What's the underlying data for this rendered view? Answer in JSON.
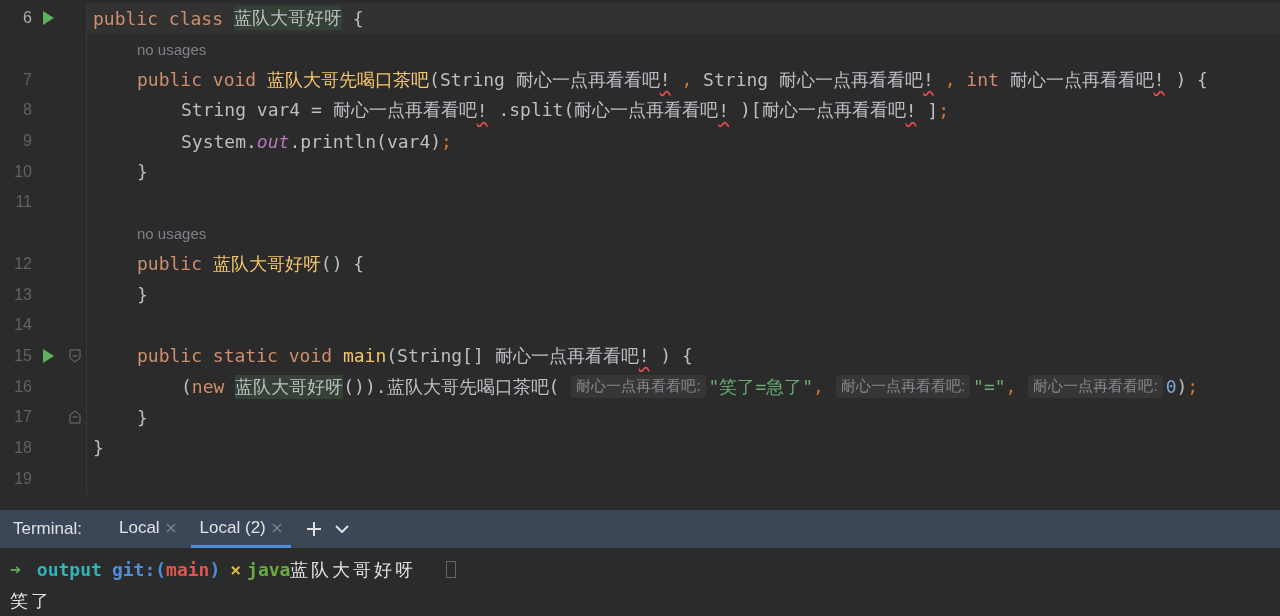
{
  "editor": {
    "rows": [
      {
        "kind": "code",
        "number": "6",
        "current": true,
        "run": true,
        "tokens": [
          {
            "t": "public class ",
            "kind": "kw"
          },
          {
            "t": "蓝队大哥好呀",
            "kind": "usage"
          },
          {
            "t": " {",
            "kind": "plain"
          }
        ],
        "children": [
          {
            "kind": "annotation",
            "text": "no usages"
          },
          {
            "kind": "code",
            "number": "7",
            "current": false,
            "run": false,
            "tokens": [
              {
                "t": "public void ",
                "kind": "kw"
              },
              {
                "t": "蓝队大哥先喝口茶吧",
                "kind": "decl"
              },
              {
                "t": "(String 耐心一点再看看吧",
                "kind": "plain"
              },
              {
                "t": "!",
                "kind": "err"
              },
              {
                "t": " ,",
                "kind": "punct"
              },
              {
                "t": " String 耐心一点再看看吧",
                "kind": "plain"
              },
              {
                "t": "!",
                "kind": "err"
              },
              {
                "t": " ,",
                "kind": "punct"
              },
              {
                "t": " int ",
                "kind": "kw"
              },
              {
                "t": "耐心一点再看看吧",
                "kind": "plain"
              },
              {
                "t": "!",
                "kind": "err"
              },
              {
                "t": " ) {",
                "kind": "plain"
              }
            ],
            "children": [
              {
                "kind": "code",
                "number": "8",
                "current": false,
                "run": false,
                "tokens": [
                  {
                    "t": "String var4 = 耐心一点再看看吧",
                    "kind": "plain"
                  },
                  {
                    "t": "!",
                    "kind": "err"
                  },
                  {
                    "t": " .split(耐心一点再看看吧",
                    "kind": "plain"
                  },
                  {
                    "t": "!",
                    "kind": "err"
                  },
                  {
                    "t": " )[耐心一点再看看吧",
                    "kind": "plain"
                  },
                  {
                    "t": "!",
                    "kind": "err"
                  },
                  {
                    "t": " ]",
                    "kind": "plain"
                  },
                  {
                    "t": ";",
                    "kind": "punct"
                  }
                ]
              },
              {
                "kind": "code",
                "number": "9",
                "current": false,
                "run": false,
                "tokens": [
                  {
                    "t": "System.",
                    "kind": "plain"
                  },
                  {
                    "t": "out",
                    "kind": "field"
                  },
                  {
                    "t": ".println(var4)",
                    "kind": "plain"
                  },
                  {
                    "t": ";",
                    "kind": "punct"
                  }
                ]
              }
            ]
          },
          {
            "kind": "code",
            "number": "10",
            "current": false,
            "run": false,
            "tokens": [
              {
                "t": "}",
                "kind": "plain"
              }
            ]
          },
          {
            "kind": "code",
            "number": "11",
            "current": false,
            "run": false
          },
          {
            "kind": "annotation",
            "text": "no usages"
          },
          {
            "kind": "code",
            "number": "12",
            "current": false,
            "run": false,
            "tokens": [
              {
                "t": "public ",
                "kind": "kw"
              },
              {
                "t": "蓝队大哥好呀",
                "kind": "decl"
              },
              {
                "t": "() {",
                "kind": "plain"
              }
            ]
          },
          {
            "kind": "code",
            "number": "13",
            "current": false,
            "run": false,
            "tokens": [
              {
                "t": "}",
                "kind": "plain"
              }
            ]
          },
          {
            "kind": "code",
            "number": "14",
            "current": false,
            "run": false
          },
          {
            "kind": "code",
            "number": "15",
            "current": false,
            "run": true,
            "fold_marker": {
              "kind": "start"
            },
            "tokens": [
              {
                "t": "public static void ",
                "kind": "kw"
              },
              {
                "t": "main",
                "kind": "decl"
              },
              {
                "t": "(String[] 耐心一点再看看吧",
                "kind": "plain"
              },
              {
                "t": "!",
                "kind": "err"
              },
              {
                "t": " ) {",
                "kind": "plain"
              }
            ],
            "children": [
              {
                "kind": "code",
                "number": "16",
                "current": false,
                "run": false,
                "tokens": [
                  {
                    "t": "(",
                    "kind": "plain"
                  },
                  {
                    "t": "new ",
                    "kind": "kw"
                  },
                  {
                    "t": "蓝队大哥好呀",
                    "kind": "usage"
                  },
                  {
                    "t": "()).蓝队大哥先喝口茶吧(",
                    "kind": "plain"
                  },
                  {
                    "t": "耐心一点再看看吧:",
                    "kind": "hint"
                  },
                  {
                    "t": "\"笑了=急了\"",
                    "kind": "str"
                  },
                  {
                    "t": ",",
                    "kind": "punct"
                  },
                  {
                    "t": "耐心一点再看看吧:",
                    "kind": "hint"
                  },
                  {
                    "t": "\"=\"",
                    "kind": "str"
                  },
                  {
                    "t": ",",
                    "kind": "punct"
                  },
                  {
                    "t": "耐心一点再看看吧:",
                    "kind": "hint"
                  },
                  {
                    "t": "0",
                    "kind": "num"
                  },
                  {
                    "t": ")",
                    "kind": "plain"
                  },
                  {
                    "t": ";",
                    "kind": "punct"
                  }
                ]
              }
            ]
          },
          {
            "kind": "code",
            "number": "17",
            "current": false,
            "run": false,
            "fold_marker": {
              "kind": "end"
            },
            "tokens": [
              {
                "t": "}",
                "kind": "plain"
              }
            ]
          }
        ]
      },
      {
        "kind": "code",
        "number": "18",
        "current": false,
        "run": false,
        "tokens": [
          {
            "t": "}",
            "kind": "plain"
          }
        ]
      },
      {
        "kind": "code",
        "number": "19",
        "current": false,
        "run": false
      }
    ]
  },
  "terminal": {
    "label": "Terminal:",
    "tabs": [
      {
        "label": "Local",
        "selected": false
      },
      {
        "label": "Local (2)",
        "selected": true
      }
    ],
    "lines": [
      {
        "cursor": true,
        "segments": [
          {
            "t": "➜",
            "kind": "arrow"
          },
          {
            "t": "output",
            "kind": "dir"
          },
          {
            "t": "git:(",
            "kind": "git"
          },
          {
            "t": "main",
            "kind": "branch"
          },
          {
            "t": ")",
            "kind": "git"
          },
          {
            "t": "×",
            "kind": "dirty"
          },
          {
            "t": "java",
            "kind": "cmd"
          },
          {
            "t": "蓝队大哥好呀",
            "kind": "out"
          }
        ]
      },
      {
        "cursor": false,
        "segments": [
          {
            "t": "笑了",
            "kind": "out"
          }
        ]
      }
    ]
  }
}
